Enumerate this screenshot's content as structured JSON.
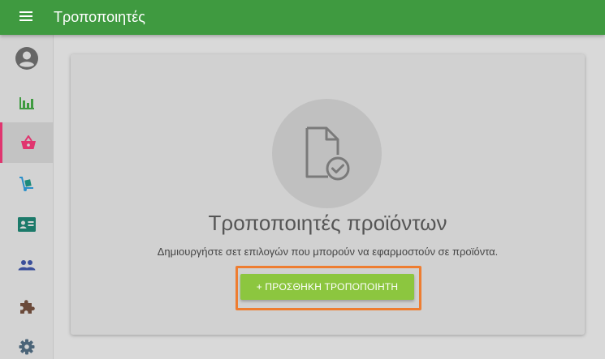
{
  "app": {
    "title": "Τροποποιητές"
  },
  "sidebar": {
    "items": [
      {
        "icon": "account-circle-icon",
        "color": "#666666"
      },
      {
        "icon": "bar-chart-icon",
        "color": "#3f9a40"
      },
      {
        "icon": "basket-icon",
        "color": "#e0356f",
        "active": true
      },
      {
        "icon": "hand-truck-icon",
        "color": "#2a8fc9"
      },
      {
        "icon": "id-card-icon",
        "color": "#1c7a6a"
      },
      {
        "icon": "people-icon",
        "color": "#3b4f9a"
      },
      {
        "icon": "puzzle-icon",
        "color": "#6b4a3a"
      },
      {
        "icon": "settings-icon",
        "color": "#4b6478"
      }
    ]
  },
  "empty_state": {
    "icon": "file-check-icon",
    "title": "Τροποποιητές προϊόντων",
    "description": "Δημιουργήστε σετ επιλογών που μπορούν να εφαρμοστούν σε προϊόντα.",
    "add_button_label": "+ ΠΡΟΣΘΗΚΗ ΤΡΟΠΟΠΟΙΗΤΗ"
  },
  "colors": {
    "topbar": "#3f9a40",
    "accent": "#e0356f",
    "button": "#8cc63f",
    "highlight": "#ee7d31"
  }
}
